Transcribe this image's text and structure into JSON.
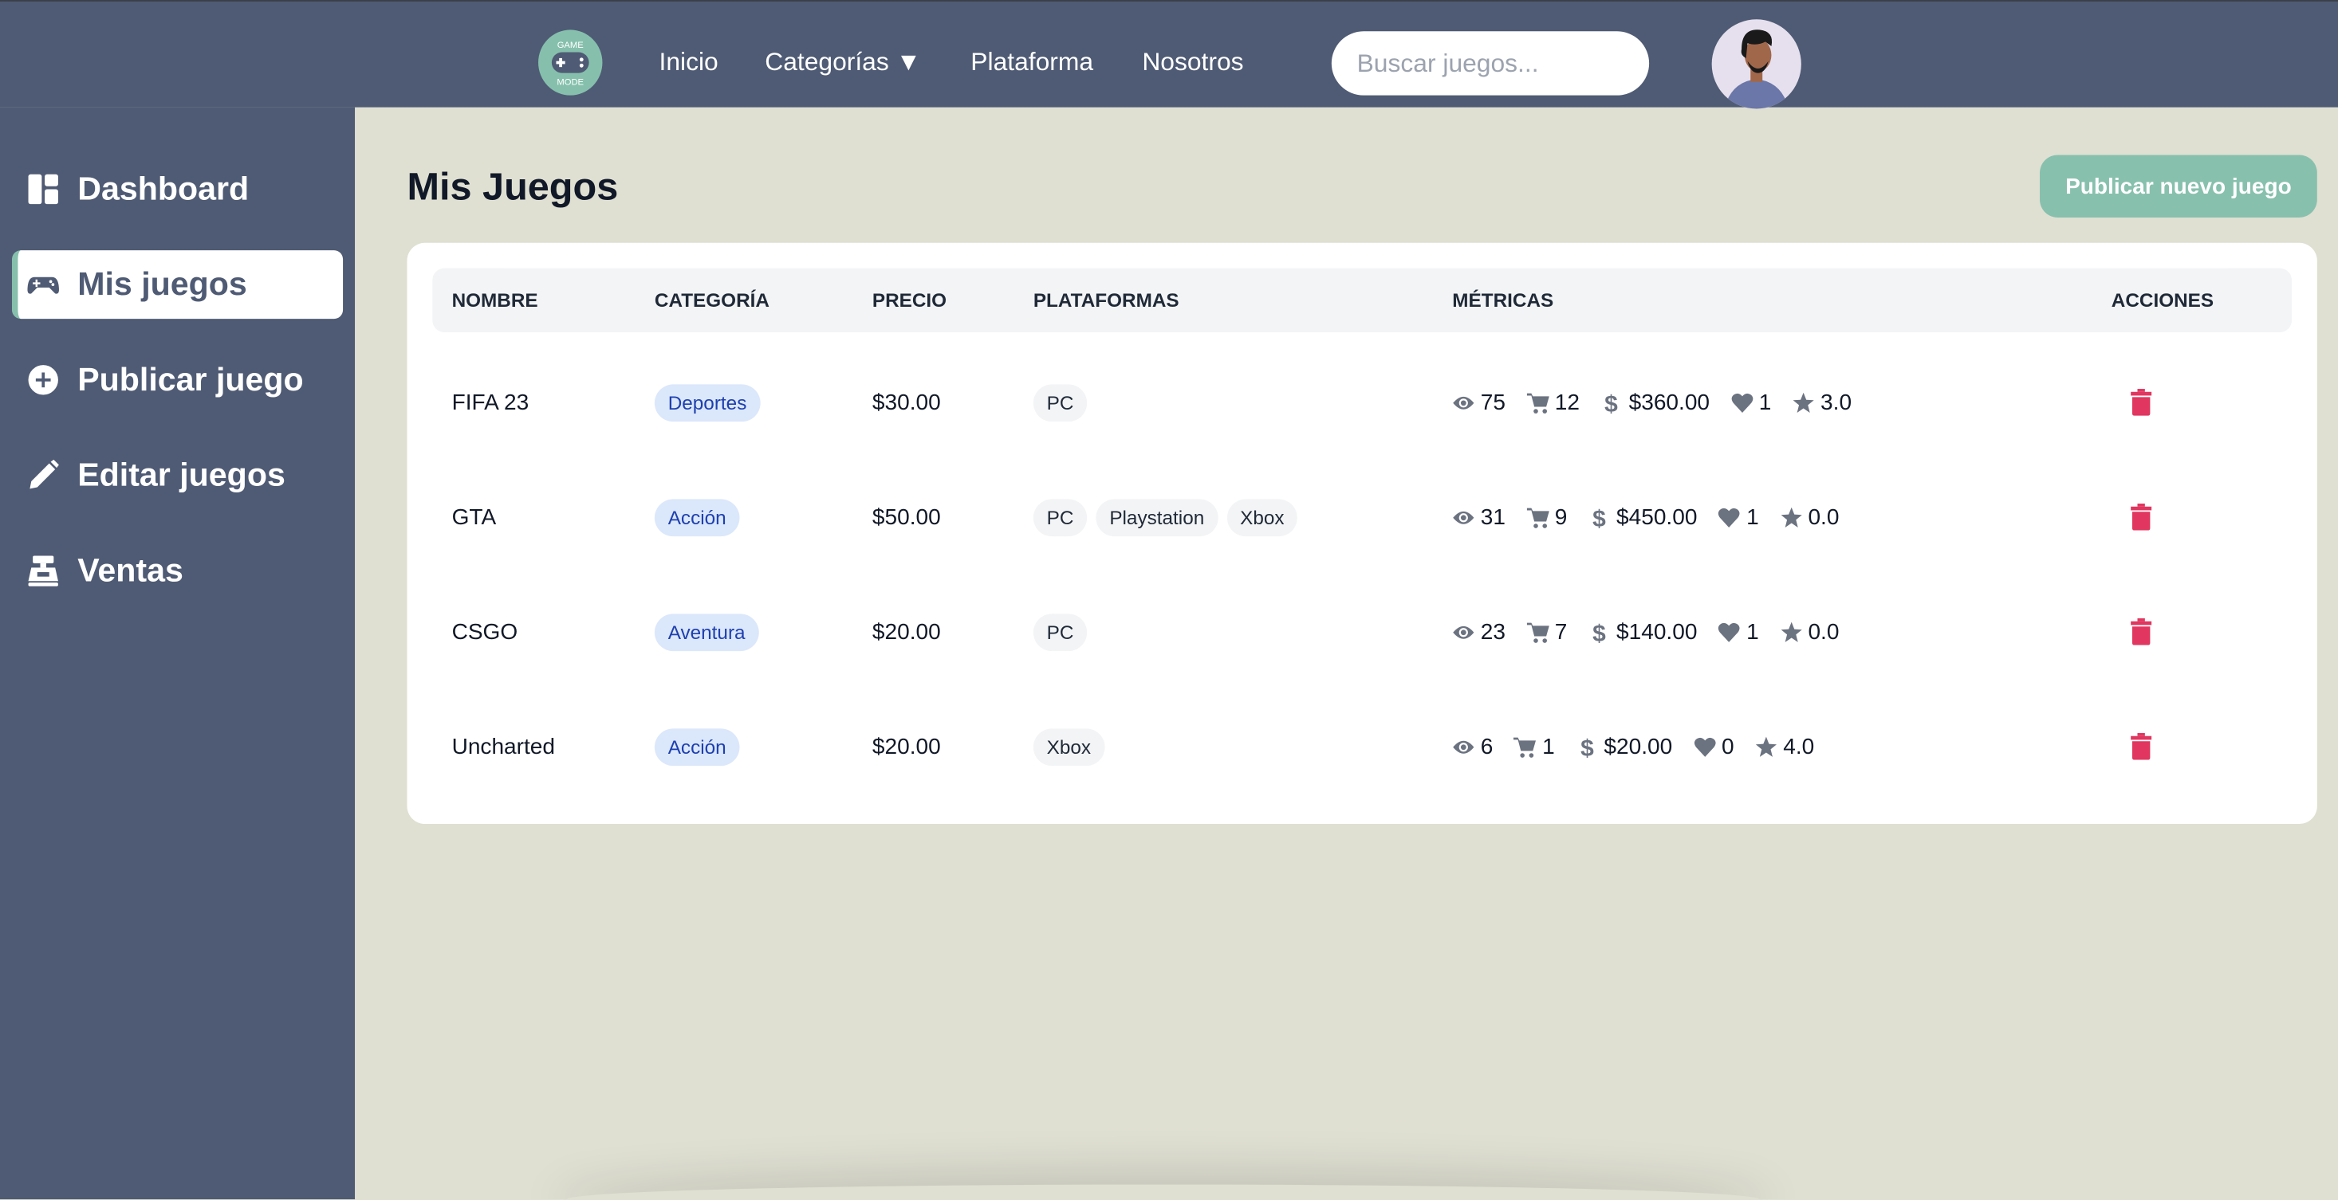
{
  "header": {
    "logo_text": [
      "GAME",
      "MODE"
    ],
    "nav": [
      {
        "label": "Inicio"
      },
      {
        "label": "Categorías ▼"
      },
      {
        "label": "Plataforma"
      },
      {
        "label": "Nosotros"
      }
    ],
    "search_placeholder": "Buscar juegos..."
  },
  "sidebar": {
    "items": [
      {
        "label": "Dashboard",
        "icon": "dashboard-icon"
      },
      {
        "label": "Mis juegos",
        "icon": "gamepad-icon",
        "active": true
      },
      {
        "label": "Publicar juego",
        "icon": "plus-circle-icon"
      },
      {
        "label": "Editar juegos",
        "icon": "pencil-icon"
      },
      {
        "label": "Ventas",
        "icon": "cash-register-icon"
      }
    ]
  },
  "main": {
    "title": "Mis Juegos",
    "publish_button": "Publicar nuevo juego",
    "columns": [
      "NOMBRE",
      "CATEGORÍA",
      "PRECIO",
      "PLATAFORMAS",
      "MÉTRICAS",
      "ACCIONES"
    ],
    "rows": [
      {
        "name": "FIFA 23",
        "category": "Deportes",
        "price": "$30.00",
        "platforms": [
          "PC"
        ],
        "views": "75",
        "sales": "12",
        "revenue": "$360.00",
        "likes": "1",
        "rating": "3.0"
      },
      {
        "name": "GTA",
        "category": "Acción",
        "price": "$50.00",
        "platforms": [
          "PC",
          "Playstation",
          "Xbox"
        ],
        "views": "31",
        "sales": "9",
        "revenue": "$450.00",
        "likes": "1",
        "rating": "0.0"
      },
      {
        "name": "CSGO",
        "category": "Aventura",
        "price": "$20.00",
        "platforms": [
          "PC"
        ],
        "views": "23",
        "sales": "7",
        "revenue": "$140.00",
        "likes": "1",
        "rating": "0.0"
      },
      {
        "name": "Uncharted",
        "category": "Acción",
        "price": "$20.00",
        "platforms": [
          "Xbox"
        ],
        "views": "6",
        "sales": "1",
        "revenue": "$20.00",
        "likes": "0",
        "rating": "4.0"
      }
    ]
  },
  "colors": {
    "header": "#4f5b74",
    "sidebar": "#4f5b74",
    "background": "#dfe0d2",
    "accent": "#88c0ae",
    "delete": "#e0365f",
    "category_badge": "#dbe7fb",
    "category_text": "#1e40af"
  }
}
